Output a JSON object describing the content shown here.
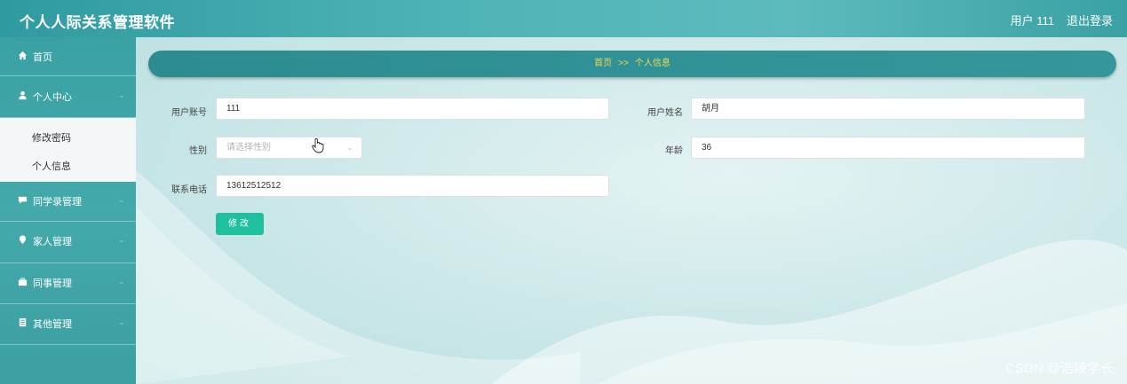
{
  "header": {
    "title": "个人人际关系管理软件",
    "user": "用户 111",
    "logout": "退出登录"
  },
  "sidebar": {
    "items": [
      {
        "label": "首页",
        "icon": "home-icon"
      },
      {
        "label": "个人中心",
        "icon": "user-icon"
      },
      {
        "label": "同学录管理",
        "icon": "comment-icon"
      },
      {
        "label": "家人管理",
        "icon": "location-icon"
      },
      {
        "label": "同事管理",
        "icon": "briefcase-icon"
      },
      {
        "label": "其他管理",
        "icon": "document-icon"
      }
    ],
    "submenu": [
      {
        "label": "修改密码"
      },
      {
        "label": "个人信息"
      }
    ]
  },
  "breadcrumb": {
    "home": "首页",
    "separator": ">>",
    "current": "个人信息"
  },
  "form": {
    "account_label": "用户账号",
    "account_value": "111",
    "name_label": "用户姓名",
    "name_value": "胡月",
    "gender_label": "性别",
    "gender_placeholder": "请选择性别",
    "age_label": "年龄",
    "age_value": "36",
    "phone_label": "联系电话",
    "phone_value": "13612512512",
    "submit_label": "修改"
  },
  "watermark": "CSDN @浩陵学长",
  "colors": {
    "accent": "#3aa1a4",
    "breadcrumb_text": "#f2d94f",
    "button": "#1fc0a0"
  }
}
